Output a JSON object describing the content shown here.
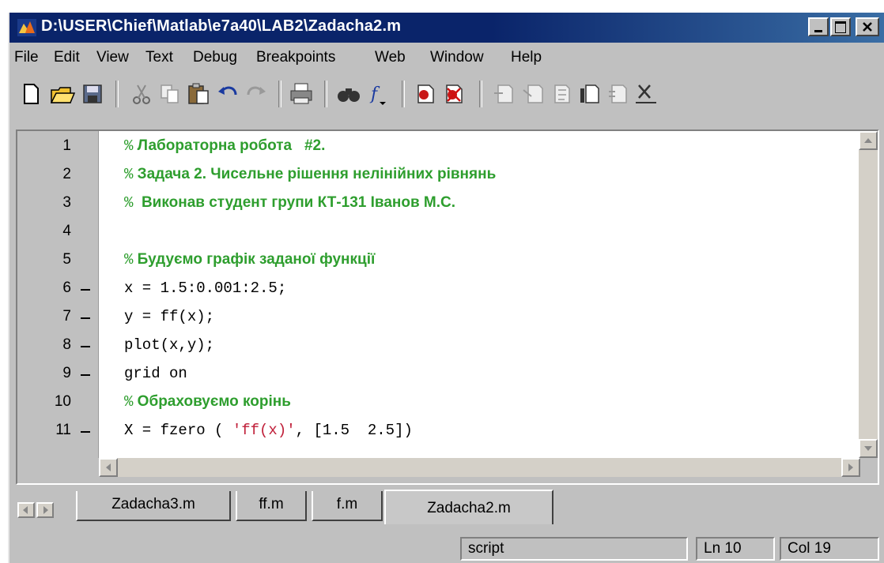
{
  "window": {
    "title": "D:\\USER\\Chief\\Matlab\\e7a40\\LAB2\\Zadacha2.m",
    "controls": [
      "minimize",
      "maximize",
      "close"
    ]
  },
  "menu": [
    "File",
    "Edit",
    "View",
    "Text",
    "Debug",
    "Breakpoints",
    "Web",
    "Window",
    "Help"
  ],
  "toolbar": {
    "icons": [
      "new-file-icon",
      "open-folder-icon",
      "save-icon",
      "cut-icon",
      "copy-icon",
      "paste-icon",
      "undo-icon",
      "redo-icon",
      "print-icon",
      "find-icon",
      "function-icon",
      "set-breakpoint-icon",
      "clear-breakpoint-icon",
      "step-icon",
      "step-in-icon",
      "step-out-icon",
      "continue-icon",
      "stack-icon",
      "exit-debug-icon"
    ]
  },
  "editor": {
    "line_numbers": [
      "1",
      "2",
      "3",
      "4",
      "5",
      "6",
      "7",
      "8",
      "9",
      "10",
      "11"
    ],
    "executable_lines": [
      6,
      7,
      8,
      9,
      11
    ],
    "lines": [
      {
        "percent": "%",
        "comment": " Лабораторна робота   #2.",
        "code": "",
        "string": "",
        "tail": ""
      },
      {
        "percent": "%",
        "comment": " Задача 2. Чисельне рішення нелінійних рівнянь",
        "code": "",
        "string": "",
        "tail": ""
      },
      {
        "percent": "%",
        "comment": "  Виконав студент групи КТ-131 Іванов М.С.",
        "code": "",
        "string": "",
        "tail": ""
      },
      {
        "percent": "",
        "comment": "",
        "code": "",
        "string": "",
        "tail": ""
      },
      {
        "percent": "%",
        "comment": " Будуємо графік заданої функції",
        "code": "",
        "string": "",
        "tail": ""
      },
      {
        "percent": "",
        "comment": "",
        "code": "x = 1.5:0.001:2.5;",
        "string": "",
        "tail": ""
      },
      {
        "percent": "",
        "comment": "",
        "code": "y = ff(x);",
        "string": "",
        "tail": ""
      },
      {
        "percent": "",
        "comment": "",
        "code": "plot(x,y);",
        "string": "",
        "tail": ""
      },
      {
        "percent": "",
        "comment": "",
        "code": "grid on",
        "string": "",
        "tail": ""
      },
      {
        "percent": "%",
        "comment": " Обраховуємо корінь",
        "code": "",
        "string": "",
        "tail": ""
      },
      {
        "percent": "",
        "comment": "",
        "code": "X = fzero ( ",
        "string": "'ff(x)'",
        "tail": ", [1.5  2.5])"
      }
    ]
  },
  "tabs": [
    "Zadacha3.m",
    "ff.m",
    "f.m",
    "Zadacha2.m"
  ],
  "active_tab": "Zadacha2.m",
  "status": {
    "mode": "script",
    "line": "Ln 10",
    "column": "Col 19"
  },
  "colors": {
    "comment": "#2e9e2e",
    "string": "#c0203a",
    "titlebar": "#0a246a"
  }
}
